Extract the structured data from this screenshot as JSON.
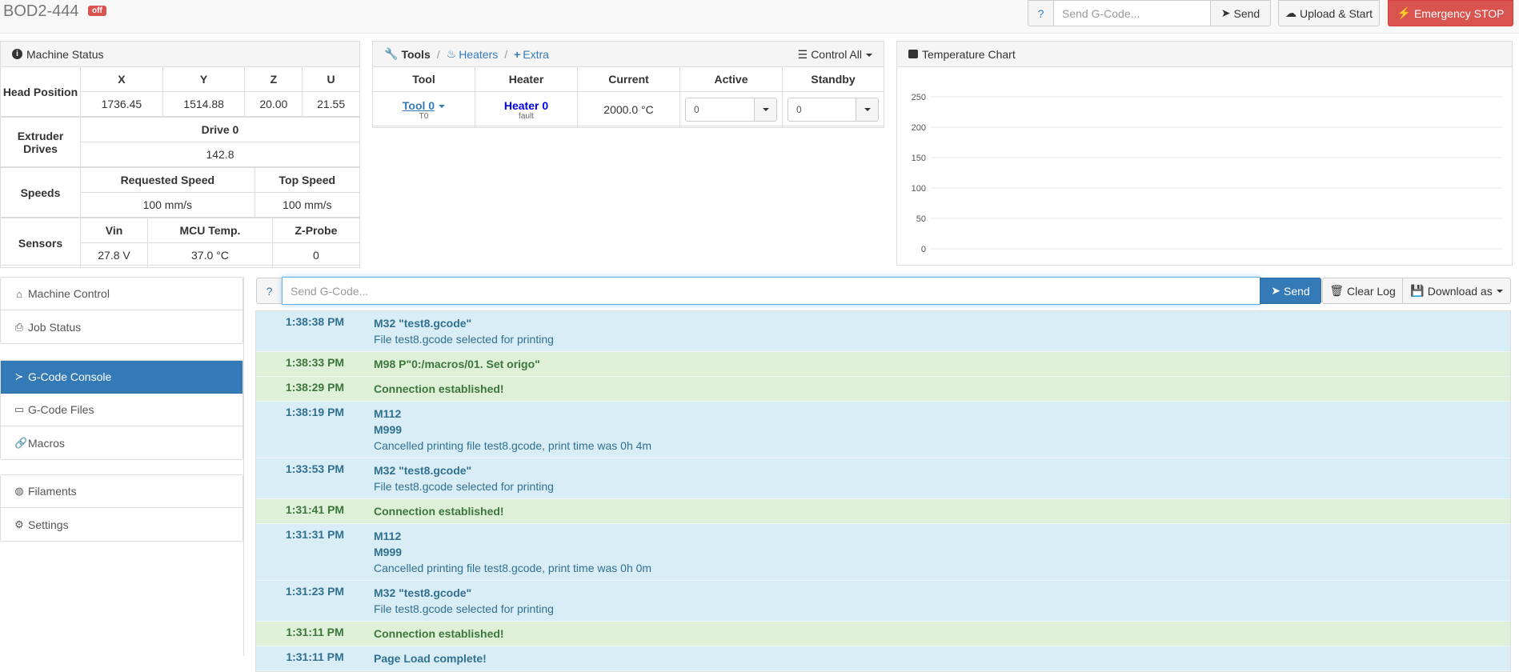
{
  "navbar": {
    "brand": "BOD2-444",
    "status_badge": "off",
    "help": "?",
    "gcode_placeholder": "Send G-Code...",
    "send": "Send",
    "upload": "Upload & Start",
    "emergency": "Emergency STOP"
  },
  "machine_status": {
    "title": "Machine Status",
    "head_position_label": "Head Position",
    "axes": [
      "X",
      "Y",
      "Z",
      "U"
    ],
    "positions": [
      "1736.45",
      "1514.88",
      "20.00",
      "21.55"
    ],
    "extruder_label": "Extruder Drives",
    "drive_label": "Drive 0",
    "drive_value": "142.8",
    "speeds_label": "Speeds",
    "requested_speed_label": "Requested Speed",
    "top_speed_label": "Top Speed",
    "requested_speed": "100 mm/s",
    "top_speed": "100 mm/s",
    "sensors_label": "Sensors",
    "vin_label": "Vin",
    "mcu_label": "MCU Temp.",
    "zprobe_label": "Z-Probe",
    "vin": "27.8 V",
    "mcu": "37.0 °C",
    "zprobe": "0"
  },
  "tools": {
    "tab_tools": "Tools",
    "tab_heaters": "Heaters",
    "tab_extra": "Extra",
    "control_all": "Control All",
    "headers": [
      "Tool",
      "Heater",
      "Current",
      "Active",
      "Standby"
    ],
    "tool_name": "Tool 0",
    "tool_sub": "T0",
    "heater_name": "Heater 0",
    "heater_state": "fault",
    "current": "2000.0 °C",
    "active": "0",
    "standby": "0"
  },
  "temp_chart": {
    "title": "Temperature Chart",
    "y_ticks": [
      "250",
      "200",
      "150",
      "100",
      "50",
      "0"
    ]
  },
  "chart_data": {
    "type": "line",
    "title": "Temperature Chart",
    "ylim": [
      0,
      250
    ],
    "y_ticks": [
      0,
      50,
      100,
      150,
      200,
      250
    ],
    "series": []
  },
  "sidebar": {
    "group1": [
      {
        "label": "Machine Control",
        "icon": "home-icon"
      },
      {
        "label": "Job Status",
        "icon": "print-icon"
      }
    ],
    "group2": [
      {
        "label": "G-Code Console",
        "icon": "console-icon"
      },
      {
        "label": "G-Code Files",
        "icon": "files-icon"
      },
      {
        "label": "Macros",
        "icon": "link-icon"
      }
    ],
    "group3": [
      {
        "label": "Filaments",
        "icon": "globe-icon"
      },
      {
        "label": "Settings",
        "icon": "gear-icon"
      }
    ]
  },
  "console": {
    "help": "?",
    "placeholder": "Send G-Code...",
    "send": "Send",
    "clear_log": "Clear Log",
    "download": "Download as",
    "entries": [
      {
        "time": "1:38:38 PM",
        "type": "info",
        "lines": [
          "M32 \"test8.gcode\""
        ],
        "detail": [
          "File test8.gcode selected for printing"
        ]
      },
      {
        "time": "1:38:33 PM",
        "type": "success",
        "lines": [
          "M98 P\"0:/macros/01. Set origo\""
        ],
        "detail": []
      },
      {
        "time": "1:38:29 PM",
        "type": "success",
        "lines": [
          "Connection established!"
        ],
        "detail": []
      },
      {
        "time": "1:38:19 PM",
        "type": "info",
        "lines": [
          "M112",
          "M999"
        ],
        "detail": [
          "Cancelled printing file test8.gcode, print time was 0h 4m"
        ]
      },
      {
        "time": "1:33:53 PM",
        "type": "info",
        "lines": [
          "M32 \"test8.gcode\""
        ],
        "detail": [
          "File test8.gcode selected for printing"
        ]
      },
      {
        "time": "1:31:41 PM",
        "type": "success",
        "lines": [
          "Connection established!"
        ],
        "detail": []
      },
      {
        "time": "1:31:31 PM",
        "type": "info",
        "lines": [
          "M112",
          "M999"
        ],
        "detail": [
          "Cancelled printing file test8.gcode, print time was 0h 0m"
        ]
      },
      {
        "time": "1:31:23 PM",
        "type": "info",
        "lines": [
          "M32 \"test8.gcode\""
        ],
        "detail": [
          "File test8.gcode selected for printing"
        ]
      },
      {
        "time": "1:31:11 PM",
        "type": "success",
        "lines": [
          "Connection established!"
        ],
        "detail": []
      },
      {
        "time": "1:31:11 PM",
        "type": "info",
        "lines": [
          "Page Load complete!"
        ],
        "detail": []
      }
    ]
  }
}
